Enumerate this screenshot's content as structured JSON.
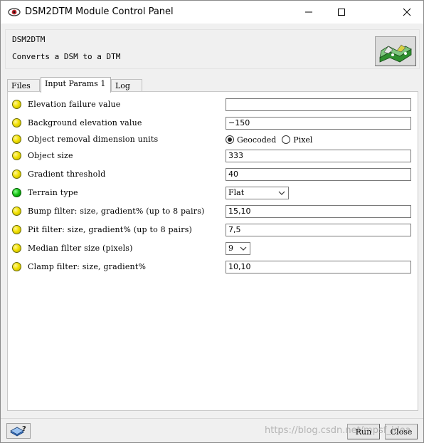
{
  "window": {
    "title": "DSM2DTM Module Control Panel",
    "controls": {
      "minimize": "minimize",
      "maximize": "maximize",
      "close": "close"
    }
  },
  "module": {
    "name": "DSM2DTM",
    "description": "Converts a DSM to a DTM"
  },
  "tabs": [
    {
      "label": "Files",
      "active": false
    },
    {
      "label": "Input Params 1",
      "active": true
    },
    {
      "label": "Log",
      "active": false
    }
  ],
  "params": {
    "elevation_failure": {
      "label": "Elevation failure value",
      "value": "",
      "status": "yellow"
    },
    "background_elevation": {
      "label": "Background elevation value",
      "value": "−150",
      "status": "yellow"
    },
    "removal_units": {
      "label": "Object removal dimension units",
      "status": "yellow",
      "options": [
        "Geocoded",
        "Pixel"
      ],
      "selected": "Geocoded"
    },
    "object_size": {
      "label": "Object size",
      "value": "333",
      "status": "yellow"
    },
    "gradient_threshold": {
      "label": "Gradient threshold",
      "value": "40",
      "status": "yellow"
    },
    "terrain_type": {
      "label": "Terrain type",
      "value": "Flat",
      "status": "green"
    },
    "bump_filter": {
      "label": "Bump filter: size, gradient% (up to 8 pairs)",
      "value": "15,10",
      "status": "yellow"
    },
    "pit_filter": {
      "label": "Pit filter: size, gradient% (up to 8 pairs)",
      "value": "7,5",
      "status": "yellow"
    },
    "median_filter": {
      "label": "Median filter size (pixels)",
      "value": "9",
      "status": "yellow"
    },
    "clamp_filter": {
      "label": "Clamp filter: size, gradient%",
      "value": "10,10",
      "status": "yellow"
    }
  },
  "buttons": {
    "run": "Run",
    "close": "Close"
  },
  "watermark": "https://blog.csdn.net/mpsf_idea",
  "colors": {
    "status_yellow": "#f2e100",
    "status_green": "#12c012",
    "panel_bg": "#ffffff",
    "window_bg": "#f0f0f0"
  },
  "icons": {
    "app": "eye-icon",
    "module_logo": "terrain-map-icon",
    "help": "help-book-icon"
  }
}
